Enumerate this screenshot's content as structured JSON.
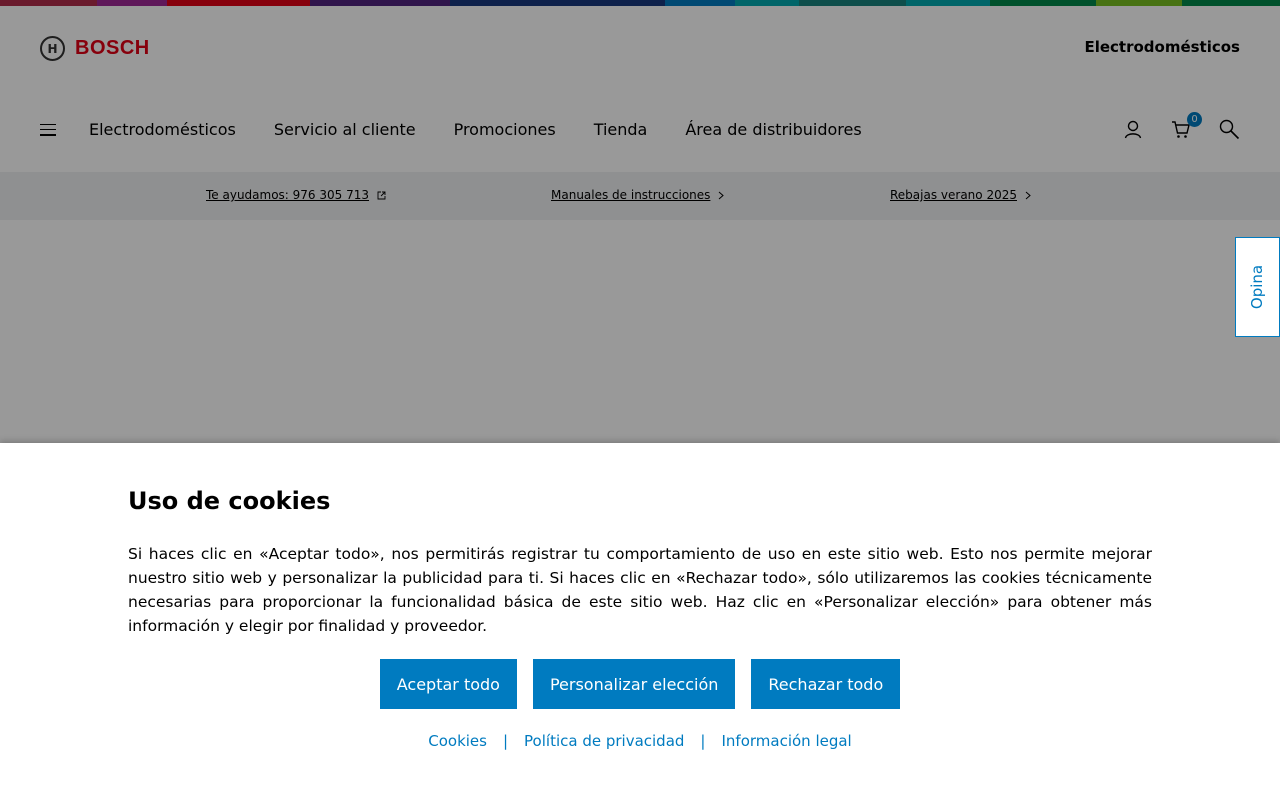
{
  "colors": {
    "accent": "#007bc0",
    "brand_red": "#e20015",
    "strip": [
      "#9e2896",
      "#b12e4c",
      "#e20015",
      "#50237f",
      "#18387d",
      "#007bc0",
      "#18837e",
      "#00884a",
      "#78be20"
    ]
  },
  "header": {
    "logo_text": "BOSCH",
    "logo_mark": "H",
    "brand_label": "Electrodomésticos",
    "nav": [
      {
        "label": "Electrodomésticos"
      },
      {
        "label": "Servicio al cliente"
      },
      {
        "label": "Promociones"
      },
      {
        "label": "Tienda"
      },
      {
        "label": "Área de distribuidores"
      }
    ],
    "icons": [
      "menu-icon",
      "user-icon",
      "cart-icon",
      "search-icon"
    ],
    "cart_count": "0"
  },
  "infobar": {
    "phone": "Te ayudamos: 976 305 713",
    "manuals": "Manuales de instrucciones",
    "sale": "Rebajas verano 2025"
  },
  "feedback_tab": "Opina",
  "cookie": {
    "title": "Uso de cookies",
    "text": "Si haces clic en «Aceptar todo», nos permitirás registrar tu comportamiento de uso en este sitio web. Esto nos permite mejorar nuestro sitio web y personalizar la publicidad para ti. Si haces clic en «Rechazar todo», sólo utilizaremos las cookies técnicamente necesarias para proporcionar la funcionalidad básica de este sitio web. Haz clic en «Personalizar elección» para obtener más información y elegir por finalidad y proveedor.",
    "accept": "Aceptar todo",
    "customize": "Personalizar elección",
    "reject": "Rechazar todo",
    "links": [
      "Cookies",
      "Política de privacidad",
      "Información legal"
    ],
    "separator": "|"
  }
}
